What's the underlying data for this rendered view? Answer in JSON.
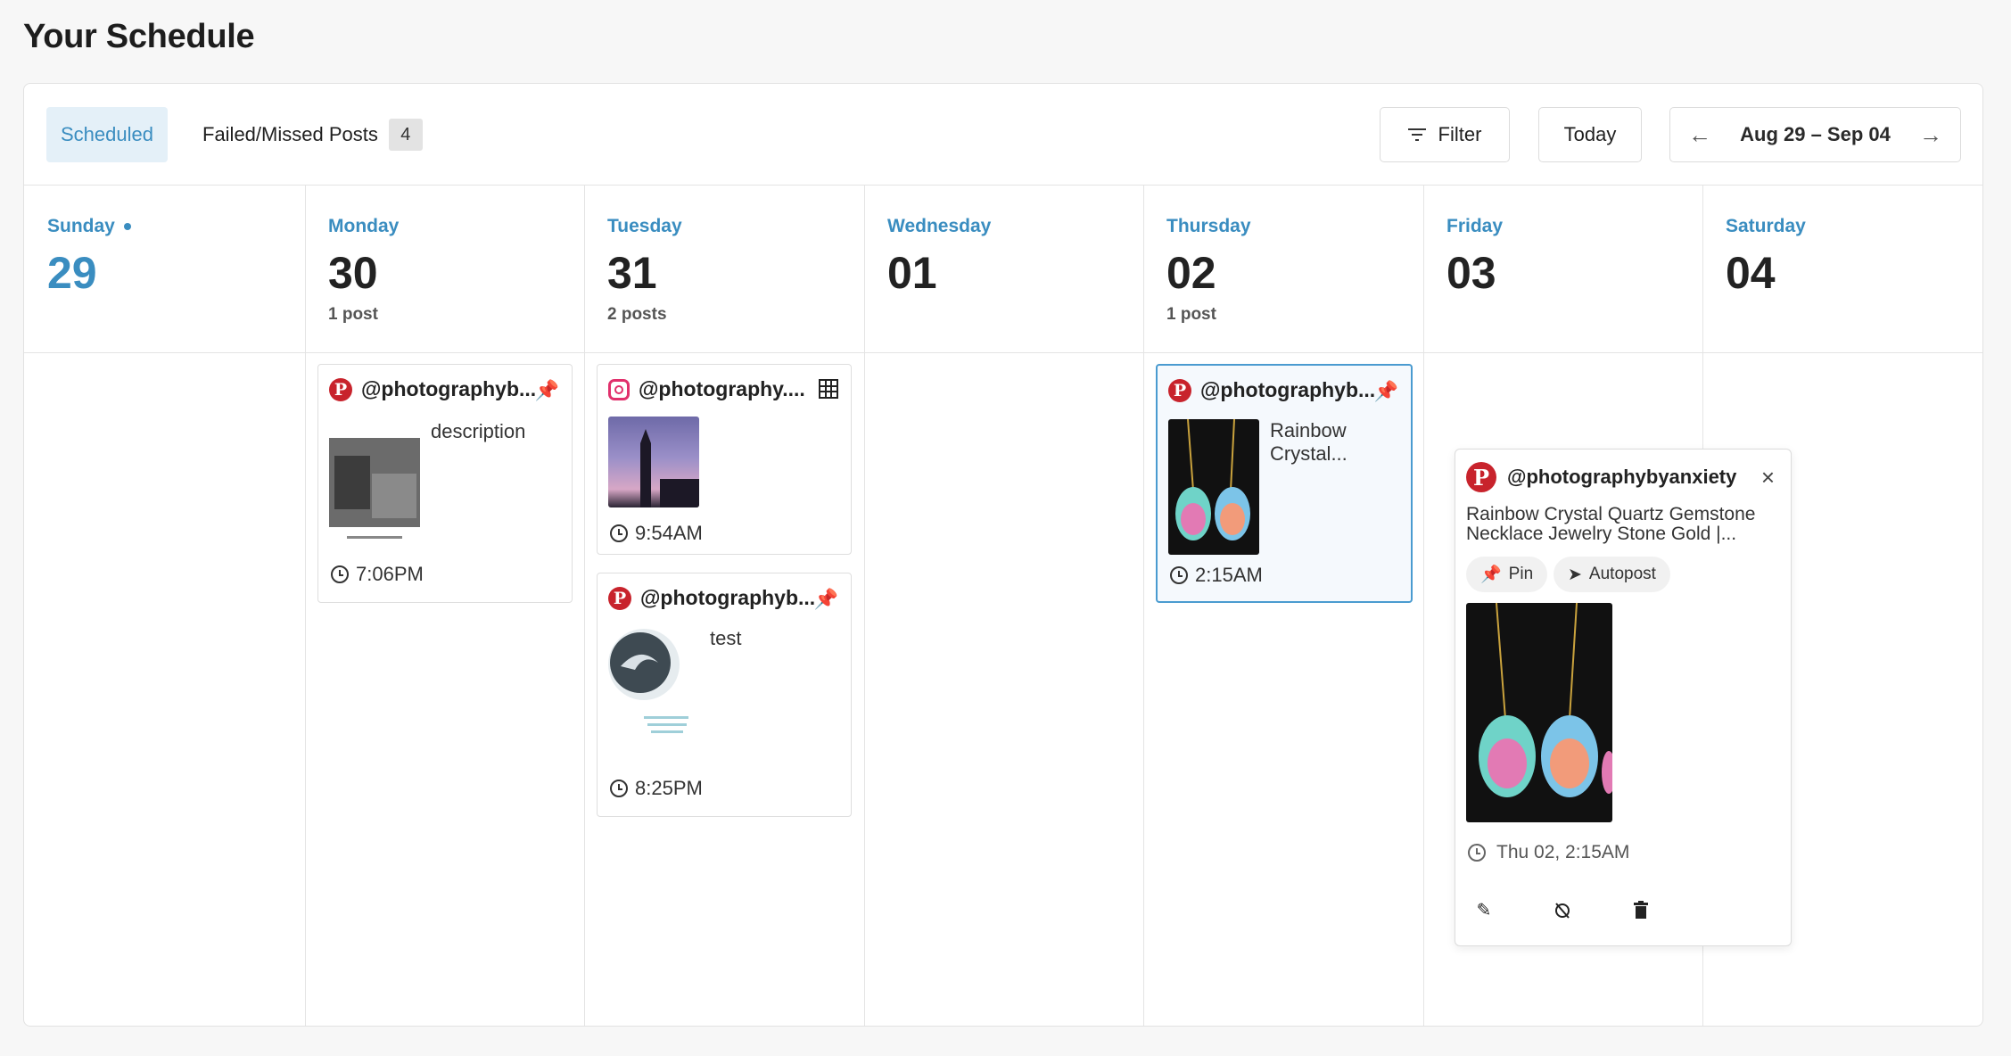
{
  "page": {
    "title": "Your Schedule"
  },
  "toolbar": {
    "tab_scheduled": "Scheduled",
    "tab_failed": "Failed/Missed Posts",
    "failed_count": "4",
    "filter_label": "Filter",
    "today_label": "Today",
    "date_range": "Aug 29 – Sep 04",
    "prev_icon": "arrow-left-icon",
    "next_icon": "arrow-right-icon"
  },
  "colors": {
    "accent": "#3a8dc0",
    "pinterest": "#c8232c",
    "instagram": "#e1306c",
    "selected_border": "#4a9bd0"
  },
  "days": [
    {
      "name": "Sunday",
      "num": "29",
      "count": "",
      "today": true
    },
    {
      "name": "Monday",
      "num": "30",
      "count": "1 post"
    },
    {
      "name": "Tuesday",
      "num": "31",
      "count": "2 posts"
    },
    {
      "name": "Wednesday",
      "num": "01",
      "count": ""
    },
    {
      "name": "Thursday",
      "num": "02",
      "count": "1 post"
    },
    {
      "name": "Friday",
      "num": "03",
      "count": ""
    },
    {
      "name": "Saturday",
      "num": "04",
      "count": ""
    }
  ],
  "posts": {
    "mon": {
      "network": "pinterest",
      "handle": "@photographyb...",
      "desc": "description",
      "time": "7:06PM",
      "icon": "pin-icon"
    },
    "tue1": {
      "network": "instagram",
      "handle": "@photography....",
      "desc": "",
      "time": "9:54AM",
      "icon": "grid-icon"
    },
    "tue2": {
      "network": "pinterest",
      "handle": "@photographyb...",
      "desc": "test",
      "time": "8:25PM",
      "icon": "pin-icon"
    },
    "thu": {
      "network": "pinterest",
      "handle": "@photographyb...",
      "desc": "Rainbow Crystal...",
      "time": "2:15AM",
      "icon": "pin-icon"
    }
  },
  "popup": {
    "handle": "@photographybyanxiety",
    "desc": "Rainbow Crystal Quartz Gemstone Necklace Jewelry Stone Gold |...",
    "chip_pin": "Pin",
    "chip_autopost": "Autopost",
    "time": "Thu 02, 2:15AM",
    "actions": [
      "edit-icon",
      "unschedule-icon",
      "delete-icon"
    ]
  }
}
